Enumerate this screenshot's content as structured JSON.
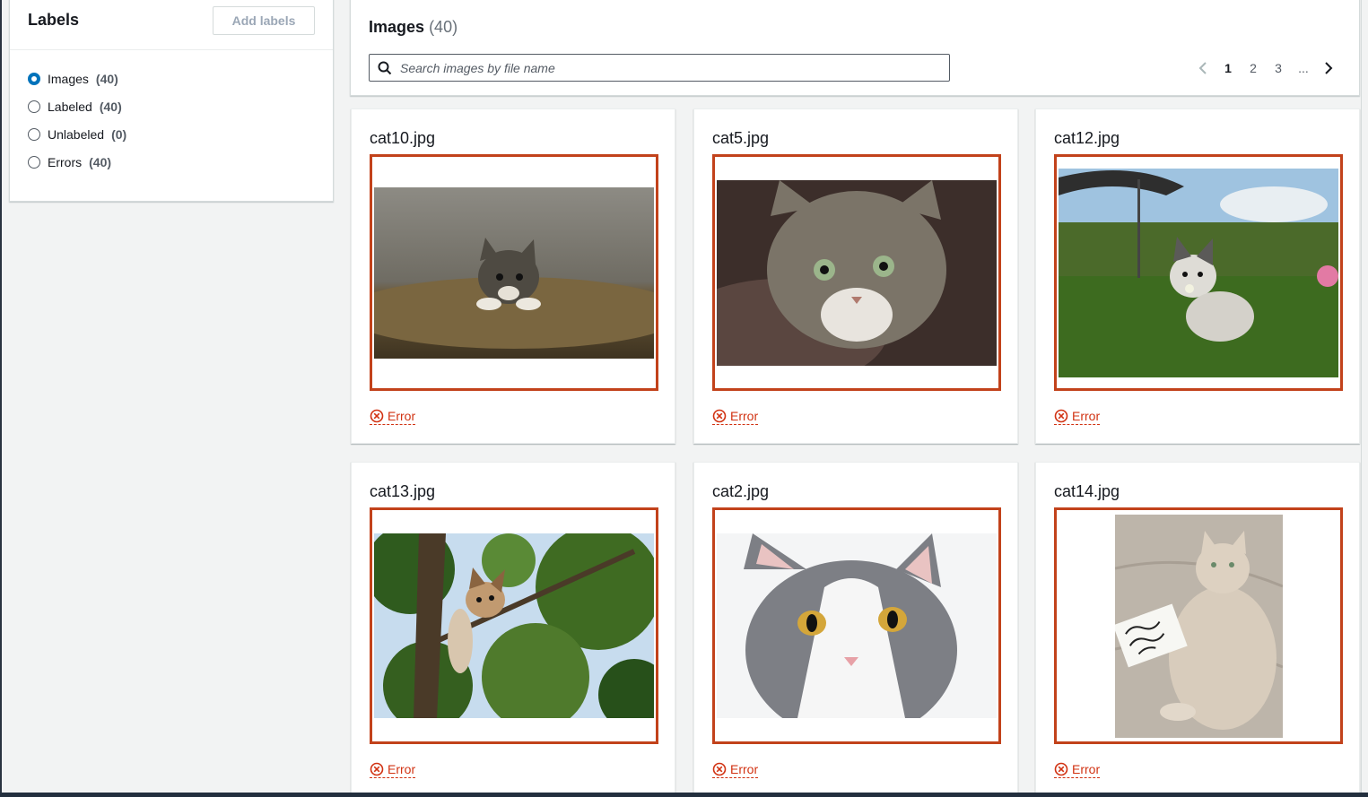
{
  "labels_panel": {
    "title": "Labels",
    "add_button": "Add labels",
    "items": [
      {
        "name": "Images",
        "count": "(40)",
        "selected": true
      },
      {
        "name": "Labeled",
        "count": "(40)",
        "selected": false
      },
      {
        "name": "Unlabeled",
        "count": "(0)",
        "selected": false
      },
      {
        "name": "Errors",
        "count": "(40)",
        "selected": false
      }
    ]
  },
  "images_panel": {
    "title": "Images",
    "count": "(40)",
    "search_placeholder": "Search images by file name",
    "pagination": {
      "pages": [
        "1",
        "2",
        "3"
      ],
      "ellipsis": "...",
      "current": "1"
    }
  },
  "cards": [
    {
      "file": "cat10.jpg",
      "status": "Error",
      "icon": "cat-kitten-on-couch-photo"
    },
    {
      "file": "cat5.jpg",
      "status": "Error",
      "icon": "tabby-cat-looking-up-photo"
    },
    {
      "file": "cat12.jpg",
      "status": "Error",
      "icon": "kitten-in-grass-photo"
    },
    {
      "file": "cat13.jpg",
      "status": "Error",
      "icon": "kitten-in-tree-photo"
    },
    {
      "file": "cat2.jpg",
      "status": "Error",
      "icon": "grey-white-cat-photo"
    },
    {
      "file": "cat14.jpg",
      "status": "Error",
      "icon": "cat-with-card-photo"
    }
  ],
  "colors": {
    "accent": "#0073bb",
    "error": "#d13212",
    "frame": "#c2421b"
  }
}
